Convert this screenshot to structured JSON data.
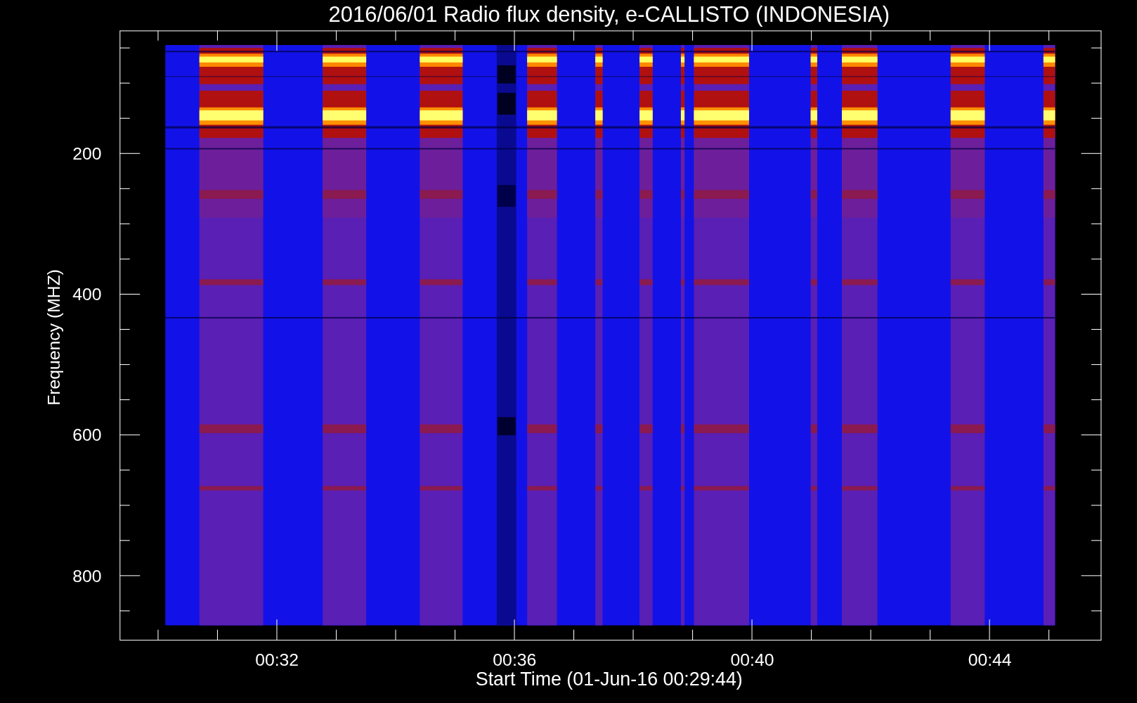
{
  "title": "2016/06/01  Radio flux density, e-CALLISTO (INDONESIA)",
  "plot": {
    "ylabel": "Frequency (MHZ)",
    "xlabel": "Start Time (01-Jun-16 00:29:44)",
    "yticks": [
      "200",
      "400",
      "600",
      "800"
    ],
    "xticks": [
      "00:32",
      "00:36",
      "00:40",
      "00:44"
    ]
  }
}
